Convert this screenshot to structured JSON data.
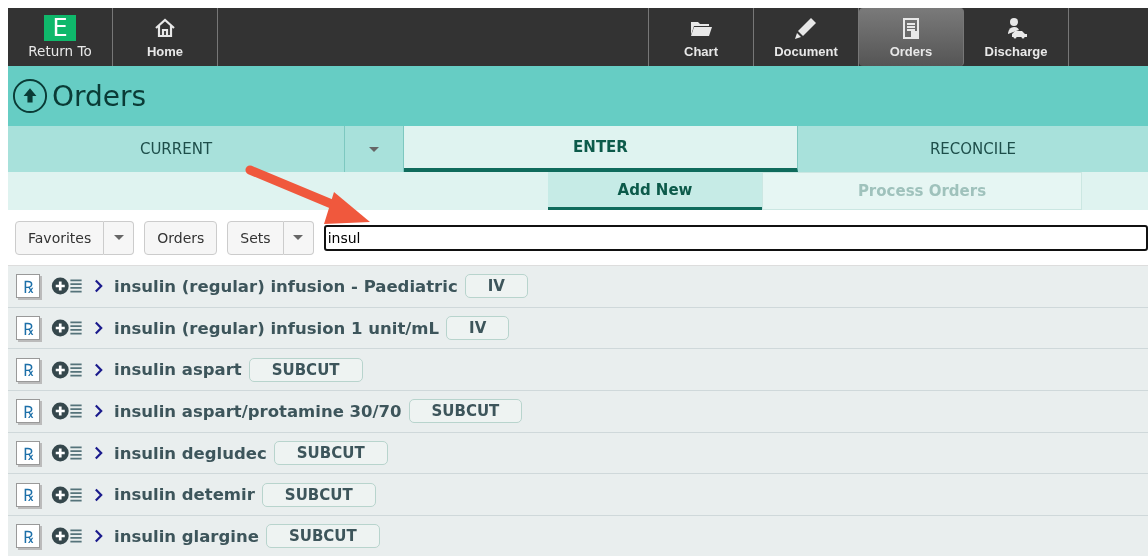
{
  "nav": {
    "logo": "E",
    "return_label": "Return To",
    "left_items": [
      {
        "label": "Home",
        "kind": "home",
        "selected": false
      }
    ],
    "right_items": [
      {
        "label": "Chart",
        "kind": "folder",
        "selected": false
      },
      {
        "label": "Document",
        "kind": "pencil",
        "selected": false
      },
      {
        "label": "Orders",
        "kind": "clipboard",
        "selected": true
      },
      {
        "label": "Discharge",
        "kind": "person-car",
        "selected": false
      }
    ]
  },
  "header": {
    "title": "Orders"
  },
  "tabs": [
    {
      "label": "CURRENT",
      "selected": false,
      "kind": "tab"
    },
    {
      "kind": "dropdown",
      "selected": false
    },
    {
      "label": "ENTER",
      "selected": true,
      "kind": "tab"
    },
    {
      "label": "RECONCILE",
      "selected": false,
      "kind": "tab"
    }
  ],
  "subtabs": [
    {
      "label": "Add New",
      "selected": true,
      "disabled": false
    },
    {
      "label": "Process Orders",
      "selected": false,
      "disabled": true
    }
  ],
  "toolbar": {
    "buttons": [
      {
        "label": "Favorites",
        "dropdown": true
      },
      {
        "label": "Orders",
        "dropdown": false
      },
      {
        "label": "Sets",
        "dropdown": true
      }
    ],
    "search": {
      "value": "insul"
    }
  },
  "orders": [
    {
      "icon": "℞",
      "name": "insulin (regular) infusion - Paediatric",
      "route": "IV"
    },
    {
      "icon": "℞",
      "name": "insulin (regular) infusion 1 unit/mL",
      "route": "IV"
    },
    {
      "icon": "℞",
      "name": "insulin aspart",
      "route": "SUBCUT"
    },
    {
      "icon": "℞",
      "name": "insulin aspart/protamine 30/70",
      "route": "SUBCUT"
    },
    {
      "icon": "℞",
      "name": "insulin degludec",
      "route": "SUBCUT"
    },
    {
      "icon": "℞",
      "name": "insulin detemir",
      "route": "SUBCUT"
    },
    {
      "icon": "℞",
      "name": "insulin glargine",
      "route": "SUBCUT"
    }
  ]
}
